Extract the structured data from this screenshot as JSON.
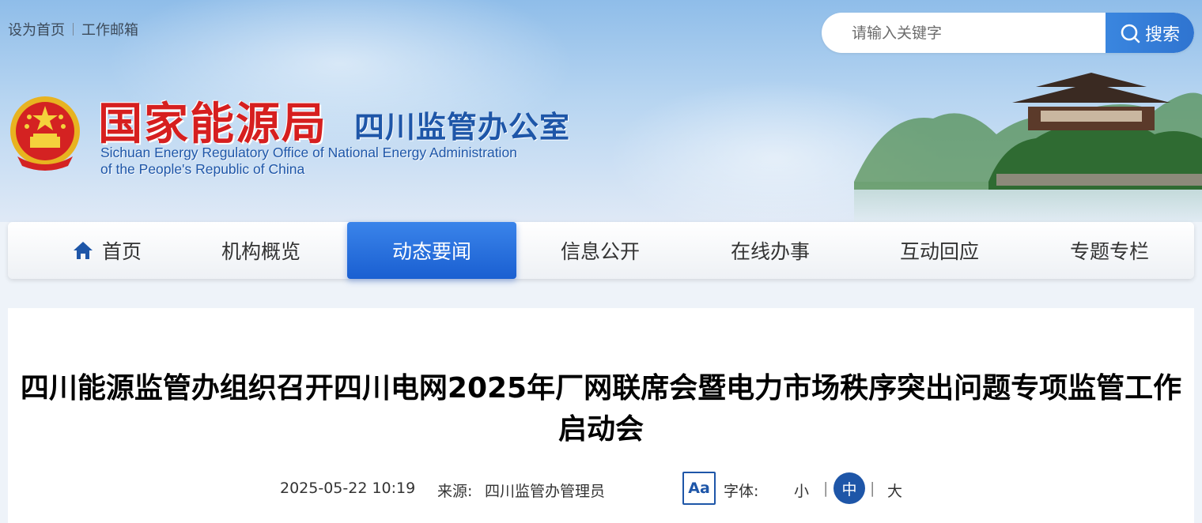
{
  "top_links": {
    "set_home": "设为首页",
    "work_mail": "工作邮箱"
  },
  "search": {
    "placeholder": "请输入关键字",
    "button_label": "搜索",
    "icon": "search-icon"
  },
  "logo": {
    "cn_title": "国家能源局",
    "sub_title": "四川监管办公室",
    "en_line1": "Sichuan Energy Regulatory Office of National Energy Administration",
    "en_line2": "of the People's Republic of China"
  },
  "nav": {
    "items": [
      {
        "label": "首页",
        "icon": "home-icon"
      },
      {
        "label": "机构概览"
      },
      {
        "label": "动态要闻",
        "active": true
      },
      {
        "label": "信息公开"
      },
      {
        "label": "在线办事"
      },
      {
        "label": "互动回应"
      },
      {
        "label": "专题专栏"
      }
    ]
  },
  "article": {
    "title": "四川能源监管办组织召开四川电网2025年厂网联席会暨电力市场秩序突出问题专项监管工作启动会",
    "date": "2025-05-22 10:19",
    "source_label": "来源:",
    "source": "四川监管办管理员",
    "font_size": {
      "icon_label": "Aa",
      "label": "字体:",
      "small": "小",
      "medium": "中",
      "large": "大",
      "selected": "中"
    }
  },
  "colors": {
    "brand_blue": "#1e56a8",
    "nav_active": "#2a6fe0",
    "logo_red": "#d61f1f"
  }
}
